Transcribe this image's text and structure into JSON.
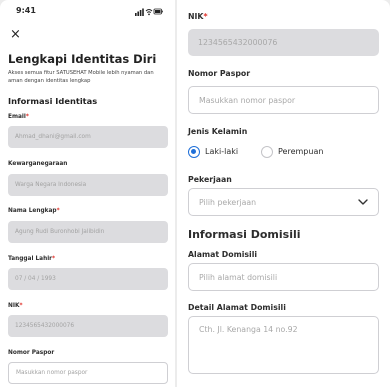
{
  "status_bar": {
    "time": "9:41"
  },
  "close": {
    "glyph": "×"
  },
  "header": {
    "title": "Lengkapi Identitas Diri",
    "subtitle": "Akses semua fitur SATUSEHAT Mobile lebih nyaman dan aman dengan identitas lengkap"
  },
  "section_identitas": "Informasi Identitas",
  "left_form": {
    "email": {
      "label": "Email",
      "value": "Ahmad_dhani@gmail.com"
    },
    "kewarganegaraan": {
      "label": "Kewarganegaraan",
      "value": "Warga Negara Indonesia"
    },
    "nama": {
      "label": "Nama Lengkap",
      "value": "Agung Rudi Buronhobi Jalibidin"
    },
    "tanggal": {
      "label": "Tanggal Lahir",
      "value": "07 / 04 / 1993"
    },
    "nik": {
      "label": "NIK",
      "value": "1234565432000076"
    },
    "paspor": {
      "label": "Nomor Paspor",
      "placeholder": "Masukkan nomor paspor"
    }
  },
  "required_mark": "*",
  "right_form": {
    "nik": {
      "label": "NIK",
      "value": "1234565432000076"
    },
    "paspor": {
      "label": "Nomor Paspor",
      "placeholder": "Masukkan nomor paspor"
    },
    "gender": {
      "label": "Jenis Kelamin",
      "option_male": "Laki-laki",
      "option_female": "Perempuan",
      "selected": "Laki-laki"
    },
    "pekerjaan": {
      "label": "Pekerjaan",
      "placeholder": "Pilih pekerjaan"
    },
    "alamat": {
      "label": "Alamat Domisili",
      "placeholder": "Pilih alamat domisili"
    },
    "detail": {
      "label": "Detail Alamat Domisili",
      "placeholder": "Cth. Jl. Kenanga 14 no.92"
    }
  },
  "section_domisili": "Informasi Domisili",
  "colors": {
    "accent": "#1f6fd8",
    "required": "#e0322b",
    "disabled_fill": "#dcdcdf"
  }
}
